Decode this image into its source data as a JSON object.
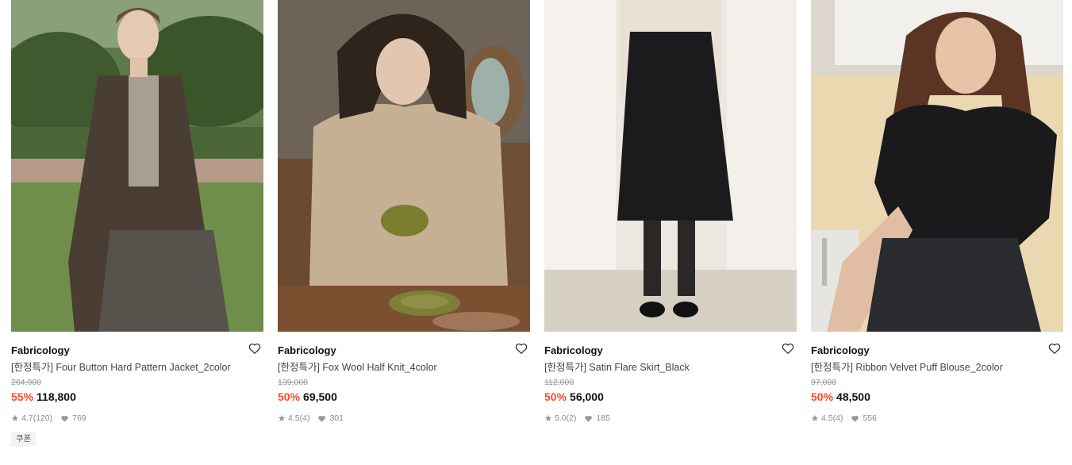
{
  "products": [
    {
      "brand": "Fabricology",
      "name": "[한정특가] Four Button Hard Pattern Jacket_2color",
      "original_price": "264,000",
      "discount": "55%",
      "price": "118,800",
      "rating": "4.7",
      "review_count": "(120)",
      "likes": "769",
      "badge": "쿠폰"
    },
    {
      "brand": "Fabricology",
      "name": "[한정특가] Fox Wool Half Knit_4color",
      "original_price": "139,000",
      "discount": "50%",
      "price": "69,500",
      "rating": "4.5",
      "review_count": "(4)",
      "likes": "301"
    },
    {
      "brand": "Fabricology",
      "name": "[한정특가] Satin Flare Skirt_Black",
      "original_price": "112,000",
      "discount": "50%",
      "price": "56,000",
      "rating": "5.0",
      "review_count": "(2)",
      "likes": "185"
    },
    {
      "brand": "Fabricology",
      "name": "[한정특가] Ribbon Velvet Puff Blouse_2color",
      "original_price": "97,000",
      "discount": "50%",
      "price": "48,500",
      "rating": "4.5",
      "review_count": "(4)",
      "likes": "556"
    }
  ],
  "colors": {
    "discount": "#ff4b1f",
    "brand_text": "#111111",
    "muted_text": "#8a8a8a"
  },
  "icons": {
    "wishlist": "heart-outline-icon",
    "rating": "star-icon",
    "likes": "heart-filled-icon"
  }
}
